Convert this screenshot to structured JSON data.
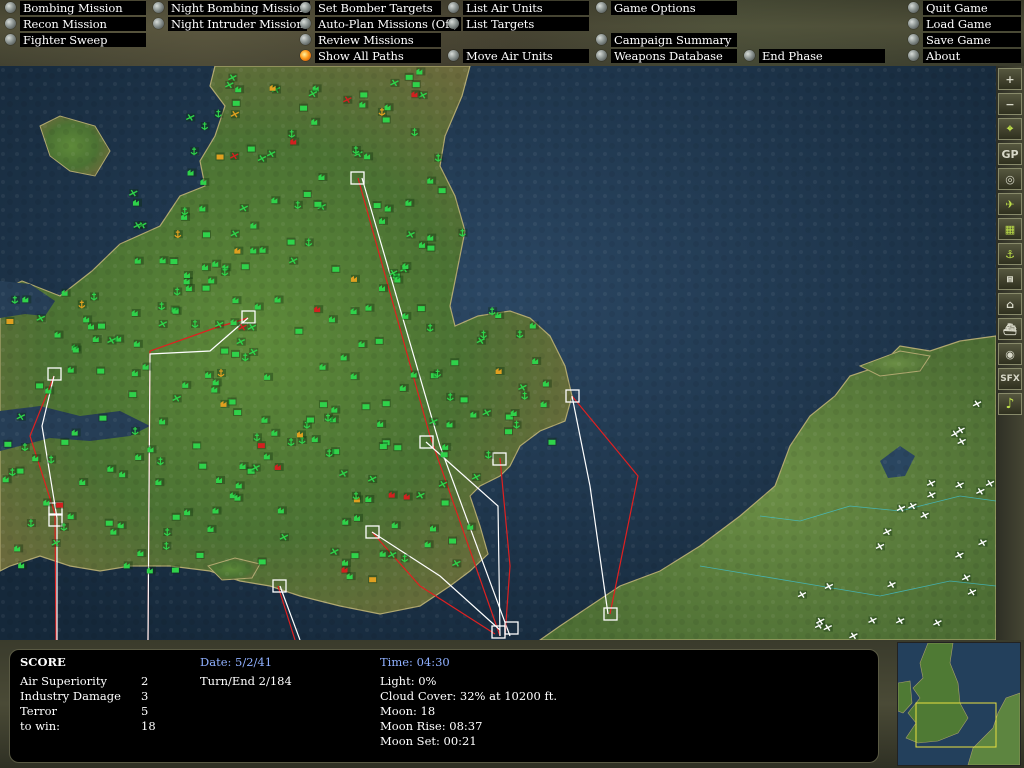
{
  "menu": {
    "col1": [
      "Bombing Mission",
      "Recon Mission",
      "Fighter Sweep"
    ],
    "col2": [
      "Night Bombing Mission",
      "Night Intruder Mission"
    ],
    "col3": [
      "Set Bomber Targets",
      "Auto-Plan Missions (Off)",
      "Review Missions",
      "Show All Paths"
    ],
    "col4": [
      "List Air Units",
      "List Targets",
      "Move Air Units"
    ],
    "col5": [
      "Game Options",
      "Campaign Summary",
      "Weapons Database"
    ],
    "col6": [
      "End Phase"
    ],
    "col7": [
      "Quit Game",
      "Load Game",
      "Save Game",
      "About"
    ]
  },
  "toolbar": {
    "buttons": [
      {
        "icon": "zoom-in-icon",
        "text": "+"
      },
      {
        "icon": "zoom-out-icon",
        "text": "−"
      },
      {
        "icon": "crosshair-icon",
        "text": "⌖"
      },
      {
        "icon": "gp-icon",
        "text": "GP"
      },
      {
        "icon": "target-icon",
        "text": "◎"
      },
      {
        "icon": "airfield-icon",
        "text": "✈"
      },
      {
        "icon": "factory-icon",
        "text": "▦"
      },
      {
        "icon": "port-icon",
        "text": "⚓"
      },
      {
        "icon": "bridge-icon",
        "text": "⩎"
      },
      {
        "icon": "building-icon",
        "text": "⌂"
      },
      {
        "icon": "ship-icon",
        "text": "⛴"
      },
      {
        "icon": "radar-icon",
        "text": "◉"
      },
      {
        "icon": "sfx-icon",
        "text": "SFX"
      },
      {
        "icon": "music-icon",
        "text": "♪"
      }
    ]
  },
  "score": {
    "title": "SCORE",
    "rows": [
      {
        "label": "Air Superiority",
        "value": "2"
      },
      {
        "label": "Industry Damage",
        "value": "3"
      },
      {
        "label": "Terror",
        "value": "5"
      },
      {
        "label": "to win:",
        "value": "18"
      }
    ],
    "date_label": "Date: 5/2/41",
    "turn": "Turn/End  2/184",
    "time_label": "Time: 04:30",
    "light": "Light: 0%",
    "cloud": "Cloud Cover: 32% at 10200 ft.",
    "moon": "Moon: 18",
    "moon_rise": "Moon Rise: 08:37",
    "moon_set": "Moon Set: 00:21"
  },
  "colors": {
    "sea": "#1f3347",
    "land": "#4f7a34",
    "unit_green": "#2fd24a",
    "route_red": "#e02020",
    "route_white": "#ffffff",
    "active": "#bfe04a"
  }
}
